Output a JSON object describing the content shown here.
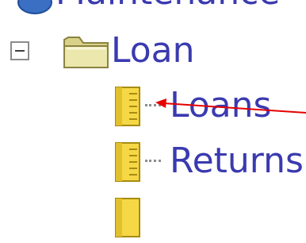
{
  "tree": {
    "top_item": {
      "label": "Maintenance",
      "icon": "globe-icon"
    },
    "loan": {
      "label": "Loan",
      "icon": "folder-icon",
      "expanded": true,
      "toggle_icon": "minus-toggle-icon"
    },
    "children": [
      {
        "label": "Loans",
        "icon": "document-icon"
      },
      {
        "label": "Returns",
        "icon": "document-icon"
      },
      {
        "label": "",
        "icon": "document-icon"
      }
    ]
  },
  "annotation": {
    "type": "arrow",
    "color": "#e60000",
    "points_to": "Loans"
  },
  "colors": {
    "label_text": "#3a3ab0",
    "folder": "#e7e3a0",
    "document": "#f4d64a"
  }
}
